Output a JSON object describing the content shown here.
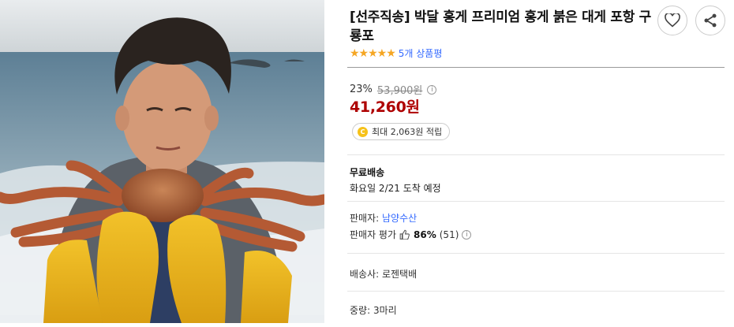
{
  "product": {
    "title": "[선주직송] 박달 홍게 프리미엄 홍게 붉은 대게 포항 구룡포",
    "stars": "★★★★★",
    "review_count": "5개 상품평",
    "rating": 5
  },
  "price": {
    "discount_rate": "23%",
    "original_price": "53,900원",
    "sale_price": "41,260원",
    "cashback_coin": "C",
    "cashback": "최대 2,063원 적립"
  },
  "shipping": {
    "type": "무료배송",
    "arrival": "화요일 2/21 도착 예정"
  },
  "seller": {
    "label": "판매자:",
    "name": "남양수산",
    "eval_label": "판매자 평가",
    "eval_score": "86%",
    "eval_count": "(51)"
  },
  "courier": "배송사: 로젠택배",
  "weight": "중량: 3마리",
  "icons": {
    "wish": "heart-icon",
    "share": "share-icon",
    "info": "info-icon",
    "thumb": "thumbs-up-icon"
  },
  "colors": {
    "sale_price": "#ae0000",
    "link": "#346aff",
    "star": "#f5a623",
    "coin": "#f6c21a"
  }
}
